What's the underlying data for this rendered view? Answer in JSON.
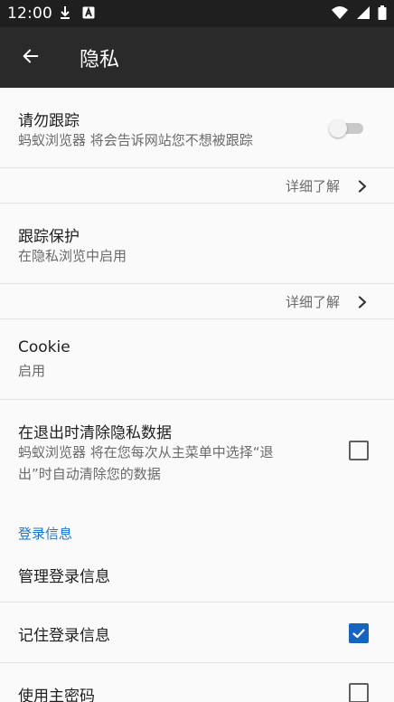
{
  "status_bar": {
    "time": "12:00",
    "icons_left": [
      "download-icon",
      "a-box-icon"
    ],
    "icons_right": [
      "wifi-icon",
      "signal-icon",
      "battery-icon"
    ]
  },
  "app_bar": {
    "title": "隐私",
    "back_icon": "arrow-left-icon"
  },
  "colors": {
    "status_bar_bg": "#1f1f1f",
    "app_bar_bg": "#2a2a2a",
    "accent_blue": "#1976d2",
    "checkbox_checked": "#1565c0",
    "text_primary": "#202020",
    "text_secondary": "#6a6a6a",
    "divider": "#e3e3e3",
    "page_bg": "#fafafa"
  },
  "settings": {
    "dnt": {
      "title": "请勿跟踪",
      "subtitle": "蚂蚁浏览器 将会告诉网站您不想被跟踪",
      "toggle_on": false,
      "learn_more": "详细了解"
    },
    "tracking_protection": {
      "title": "跟踪保护",
      "subtitle": "在隐私浏览中启用",
      "learn_more": "详细了解"
    },
    "cookie": {
      "title": "Cookie",
      "subtitle": "启用"
    },
    "clear_on_exit": {
      "title": "在退出时清除隐私数据",
      "subtitle_line1": "蚂蚁浏览器 将在您每次从主菜单中选择“退",
      "subtitle_line2": "出”时自动清除您的数据",
      "checked": false
    },
    "login_section": {
      "header": "登录信息",
      "manage": "管理登录信息",
      "remember": {
        "label": "记住登录信息",
        "checked": true
      },
      "master_password": {
        "label": "使用主密码",
        "checked": false
      }
    }
  }
}
